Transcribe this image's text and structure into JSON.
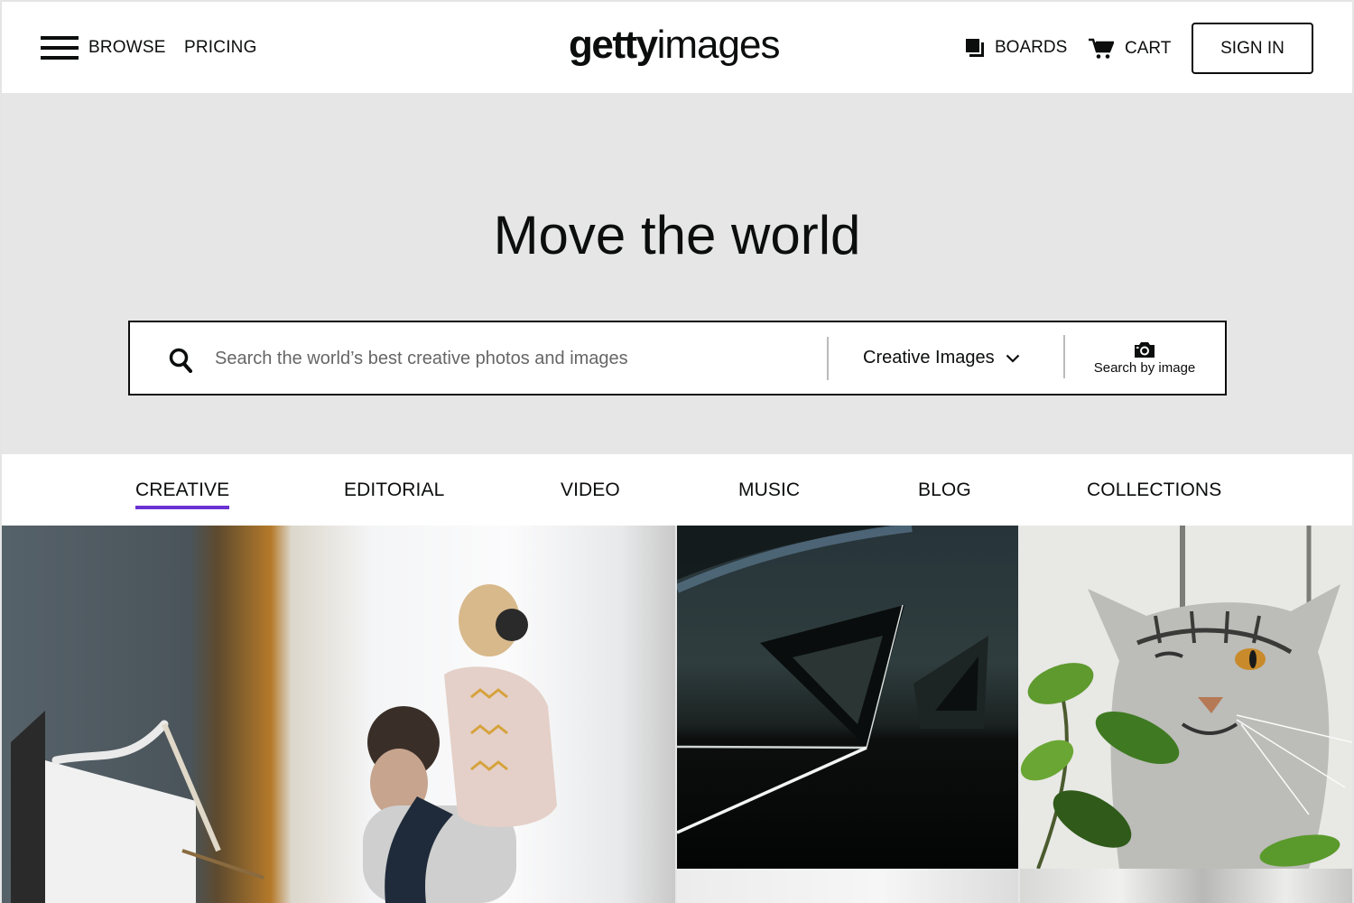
{
  "header": {
    "menu_icon": "hamburger-menu-icon",
    "browse_label": "BROWSE",
    "pricing_label": "PRICING",
    "logo": {
      "bold": "getty",
      "light": "images"
    },
    "boards_label": "BOARDS",
    "boards_icon": "boards-stack-icon",
    "cart_label": "CART",
    "cart_icon": "shopping-cart-icon",
    "signin_label": "SIGN IN"
  },
  "hero": {
    "title": "Move the world",
    "search": {
      "icon": "search-icon",
      "placeholder": "Search the world’s best creative photos and images",
      "value": "",
      "type_selected": "Creative Images",
      "type_icon": "chevron-down-icon",
      "by_image_icon": "camera-icon",
      "by_image_label": "Search by image"
    }
  },
  "tabs": [
    {
      "label": "CREATIVE",
      "active": true
    },
    {
      "label": "EDITORIAL",
      "active": false
    },
    {
      "label": "VIDEO",
      "active": false
    },
    {
      "label": "MUSIC",
      "active": false
    },
    {
      "label": "BLOG",
      "active": false
    },
    {
      "label": "COLLECTIONS",
      "active": false
    }
  ],
  "colors": {
    "accent": "#6a32d4",
    "text": "#0c0d0d",
    "hero_bg": "#e6e6e6",
    "header_bg": "#ffffff"
  },
  "images": [
    {
      "alt": "Girl with headphones sitting on father's shoulders at a desk by a window"
    },
    {
      "alt": "Abstract dark geometric triangles with light line"
    },
    {
      "alt": "Tabby cat winking while biting a green plant"
    },
    {
      "alt": "Bright white abstract architecture"
    },
    {
      "alt": "Crumpled white paper texture"
    }
  ]
}
